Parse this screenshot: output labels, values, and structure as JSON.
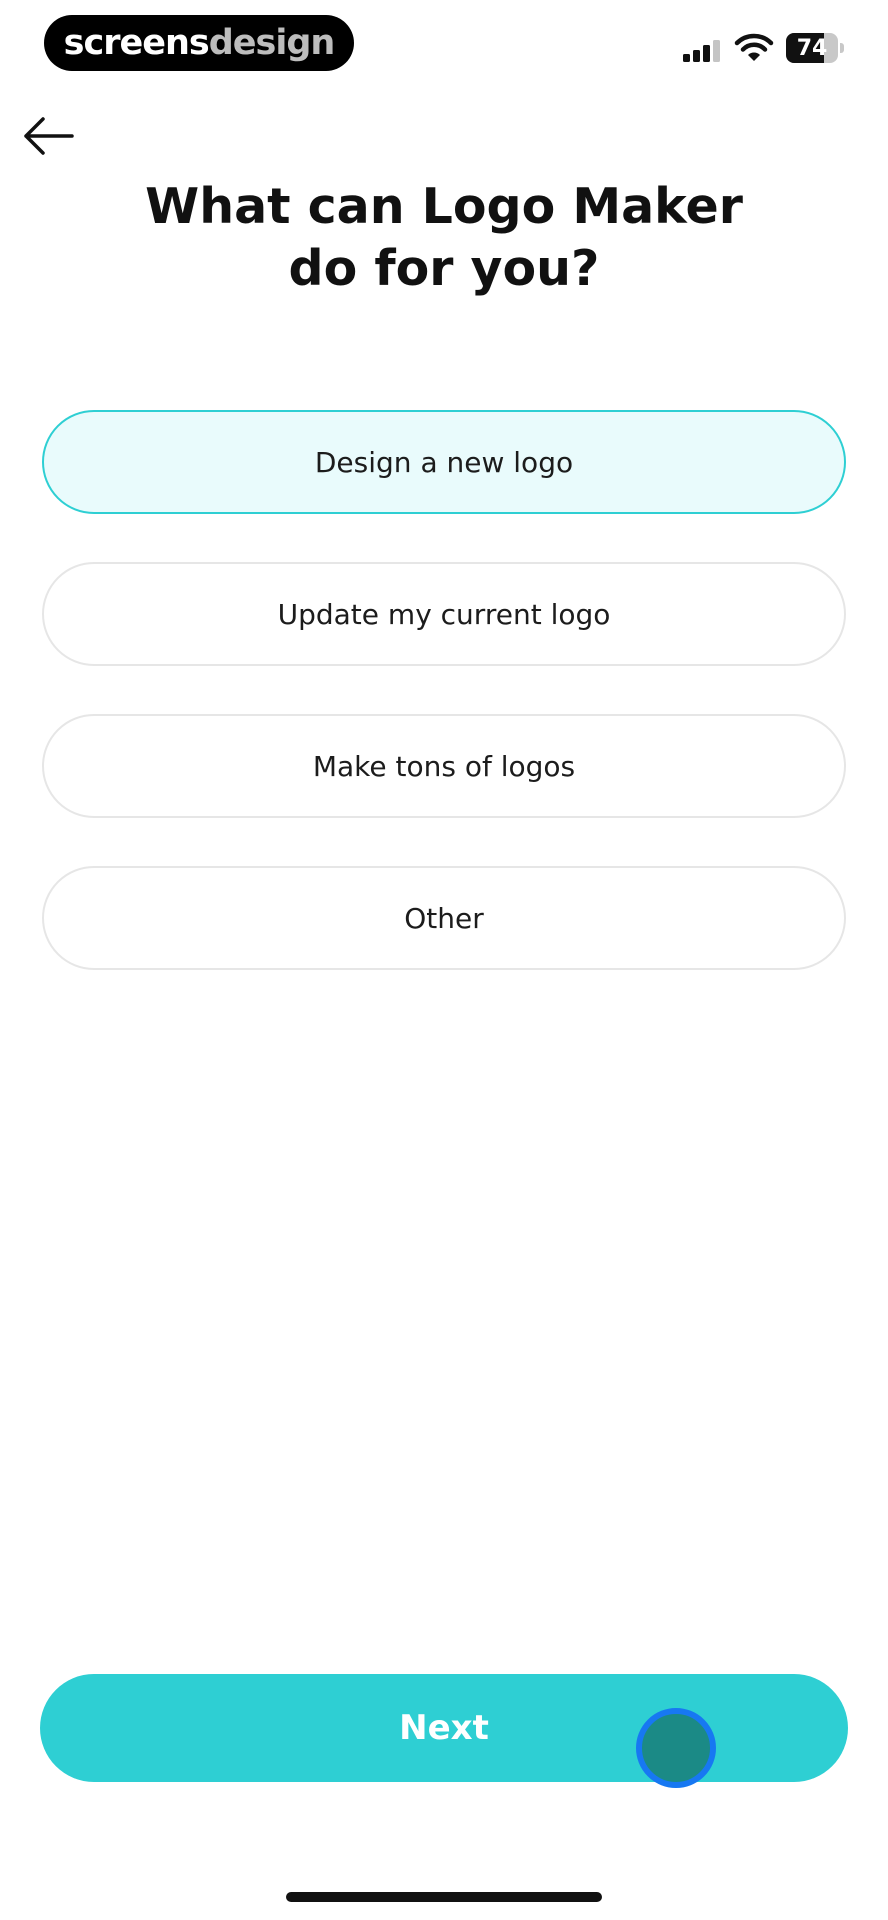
{
  "status_bar": {
    "brand_part1": "screens",
    "brand_part2": "design",
    "battery_level": "74",
    "icons": [
      "cellular-signal-icon",
      "wifi-icon",
      "battery-icon"
    ]
  },
  "nav": {
    "back_icon": "arrow-left-icon"
  },
  "title": "What can Logo Maker\ndo for you?",
  "options": [
    {
      "label": "Design a new logo",
      "selected": true
    },
    {
      "label": "Update my current logo",
      "selected": false
    },
    {
      "label": "Make tons of logos",
      "selected": false
    },
    {
      "label": "Other",
      "selected": false
    }
  ],
  "next_button": {
    "label": "Next"
  },
  "colors": {
    "accent": "#2ecfd3",
    "selected_background": "#e9fbfc",
    "touch_indicator_ring": "#1778f2"
  }
}
